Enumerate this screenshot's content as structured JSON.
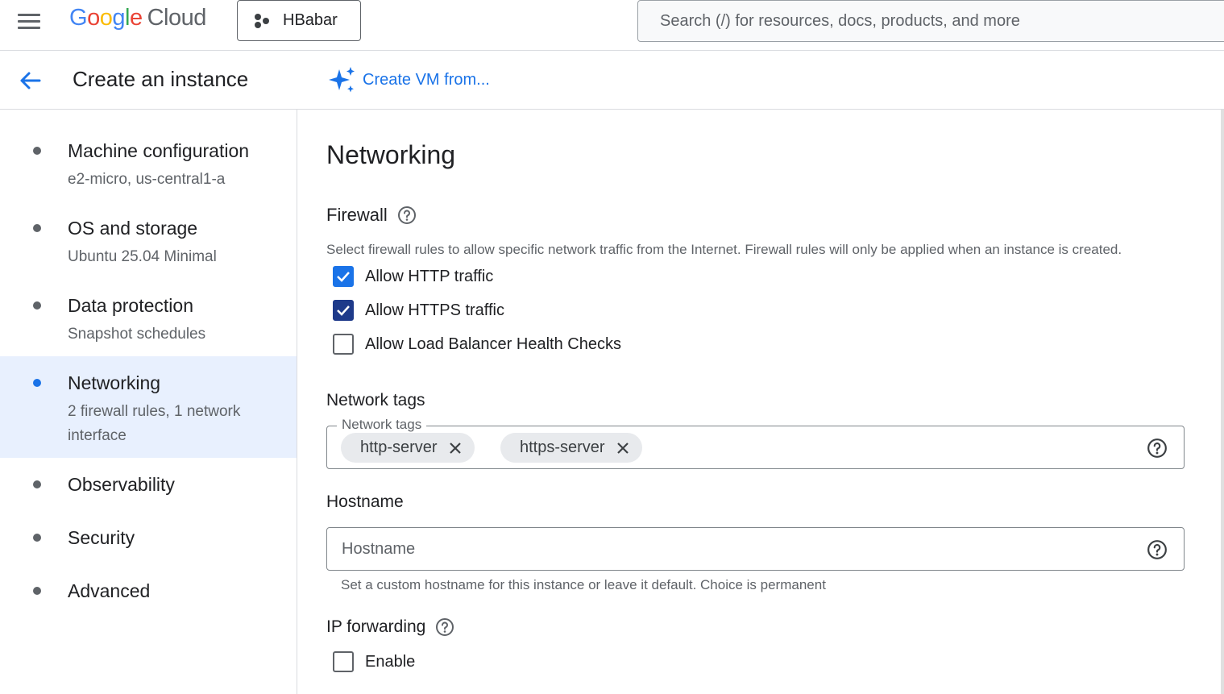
{
  "header": {
    "logo_google": "Google",
    "logo_cloud": "Cloud",
    "project_name": "HBabar",
    "search_placeholder": "Search (/) for resources, docs, products, and more"
  },
  "subheader": {
    "title": "Create an instance",
    "create_from_label": "Create VM from..."
  },
  "sidebar": {
    "items": [
      {
        "title": "Machine configuration",
        "subtitle": "e2-micro, us-central1-a"
      },
      {
        "title": "OS and storage",
        "subtitle": "Ubuntu 25.04 Minimal"
      },
      {
        "title": "Data protection",
        "subtitle": "Snapshot schedules"
      },
      {
        "title": "Networking",
        "subtitle": "2 firewall rules, 1 network interface",
        "active": true
      },
      {
        "title": "Observability",
        "subtitle": ""
      },
      {
        "title": "Security",
        "subtitle": ""
      },
      {
        "title": "Advanced",
        "subtitle": ""
      }
    ]
  },
  "main": {
    "section_title": "Networking",
    "firewall": {
      "title": "Firewall",
      "description": "Select firewall rules to allow specific network traffic from the Internet. Firewall rules will only be applied when an instance is created.",
      "options": [
        {
          "label": "Allow HTTP traffic",
          "checked": true
        },
        {
          "label": "Allow HTTPS traffic",
          "checked": true
        },
        {
          "label": "Allow Load Balancer Health Checks",
          "checked": false
        }
      ]
    },
    "network_tags": {
      "title": "Network tags",
      "field_label": "Network tags",
      "tags": [
        "http-server",
        "https-server"
      ]
    },
    "hostname": {
      "title": "Hostname",
      "placeholder": "Hostname",
      "value": "",
      "helper": "Set a custom hostname for this instance or leave it default. Choice is permanent"
    },
    "ip_forwarding": {
      "title": "IP forwarding",
      "option_label": "Enable",
      "checked": false
    }
  },
  "colors": {
    "accent": "#1a73e8",
    "active_bg": "#e8f0fe",
    "chip_bg": "#e8eaed"
  }
}
